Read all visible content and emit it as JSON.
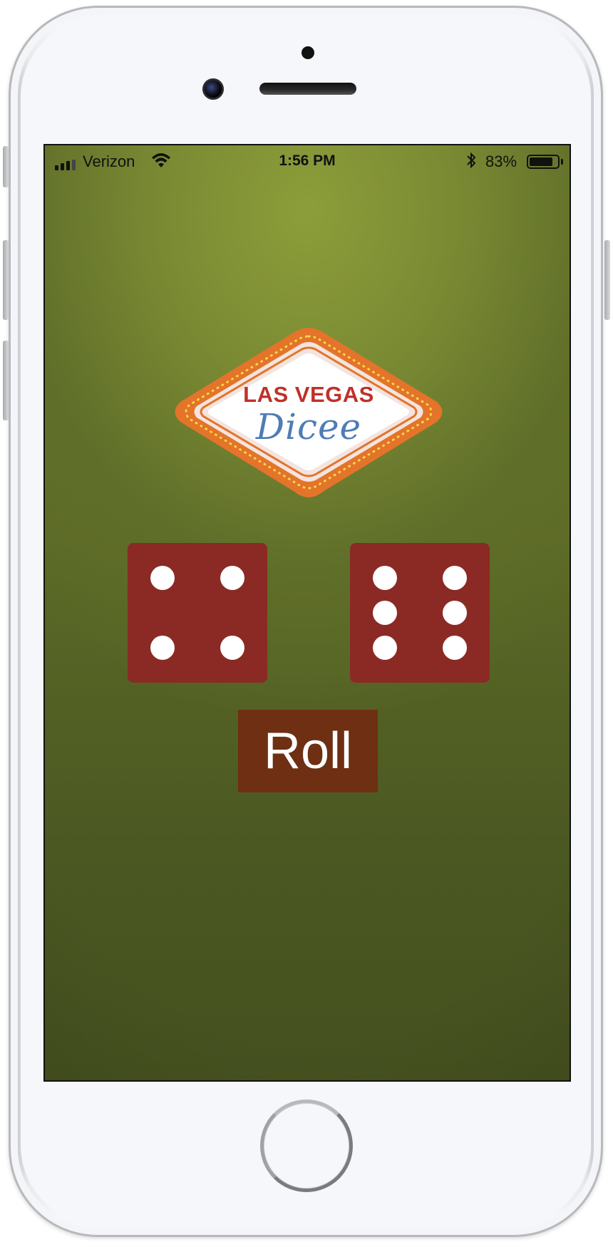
{
  "status_bar": {
    "carrier": "Verizon",
    "time": "1:56 PM",
    "battery_percent": "83%",
    "battery_level": 0.83,
    "icons": [
      "signal-bars-icon",
      "wifi-icon",
      "bluetooth-icon",
      "battery-icon"
    ]
  },
  "logo": {
    "line1": "LAS VEGAS",
    "line2": "Dicee"
  },
  "dice": {
    "left_value": 4,
    "right_value": 6,
    "color": "#8b2a24",
    "pip_color": "#ffffff"
  },
  "roll_button": {
    "label": "Roll",
    "color": "#6e2f13"
  },
  "colors": {
    "felt_light": "#8c9d3a",
    "felt_dark": "#45511f",
    "logo_red": "#c0302a",
    "logo_blue": "#4f7cb5",
    "logo_orange": "#e3742a"
  }
}
